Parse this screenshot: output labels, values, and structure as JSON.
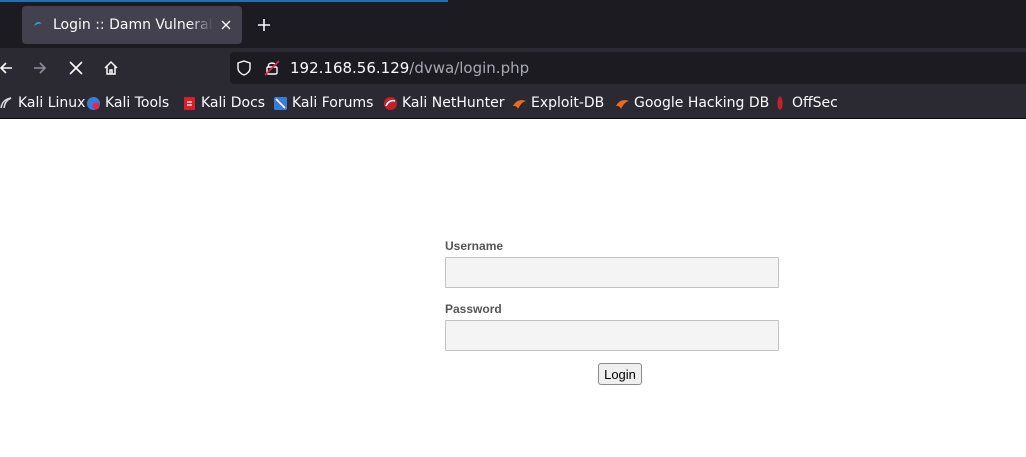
{
  "browser": {
    "tab": {
      "title": "Login :: Damn Vulnerable Web Application (DVWA)",
      "favicon": "dvwa-favicon-icon"
    },
    "new_tab_icon": "plus-icon",
    "nav": {
      "back_icon": "arrow-left-icon",
      "forward_icon": "arrow-right-icon",
      "stop_icon": "close-icon",
      "home_icon": "home-icon"
    },
    "url": {
      "host": "192.168.56.129",
      "path": "/dvwa/login.php"
    },
    "bookmarks": [
      {
        "label": "Kali Linux",
        "icon": "kali-dragon-icon"
      },
      {
        "label": "Kali Tools",
        "icon": "kali-tools-icon"
      },
      {
        "label": "Kali Docs",
        "icon": "kali-docs-icon"
      },
      {
        "label": "Kali Forums",
        "icon": "kali-forums-icon"
      },
      {
        "label": "Kali NetHunter",
        "icon": "nethunter-icon"
      },
      {
        "label": "Exploit-DB",
        "icon": "exploit-db-icon"
      },
      {
        "label": "Google Hacking DB",
        "icon": "ghdb-icon"
      },
      {
        "label": "OffSec",
        "icon": "offsec-icon"
      }
    ]
  },
  "login": {
    "username_label": "Username",
    "username_value": "",
    "password_label": "Password",
    "password_value": "",
    "submit_label": "Login"
  },
  "colors": {
    "tab_strip": "#1c1b22",
    "toolbar": "#2b2a33",
    "active_tab": "#42414d",
    "accent": "#1f6fb5",
    "input_bg": "#f4f4f4"
  }
}
